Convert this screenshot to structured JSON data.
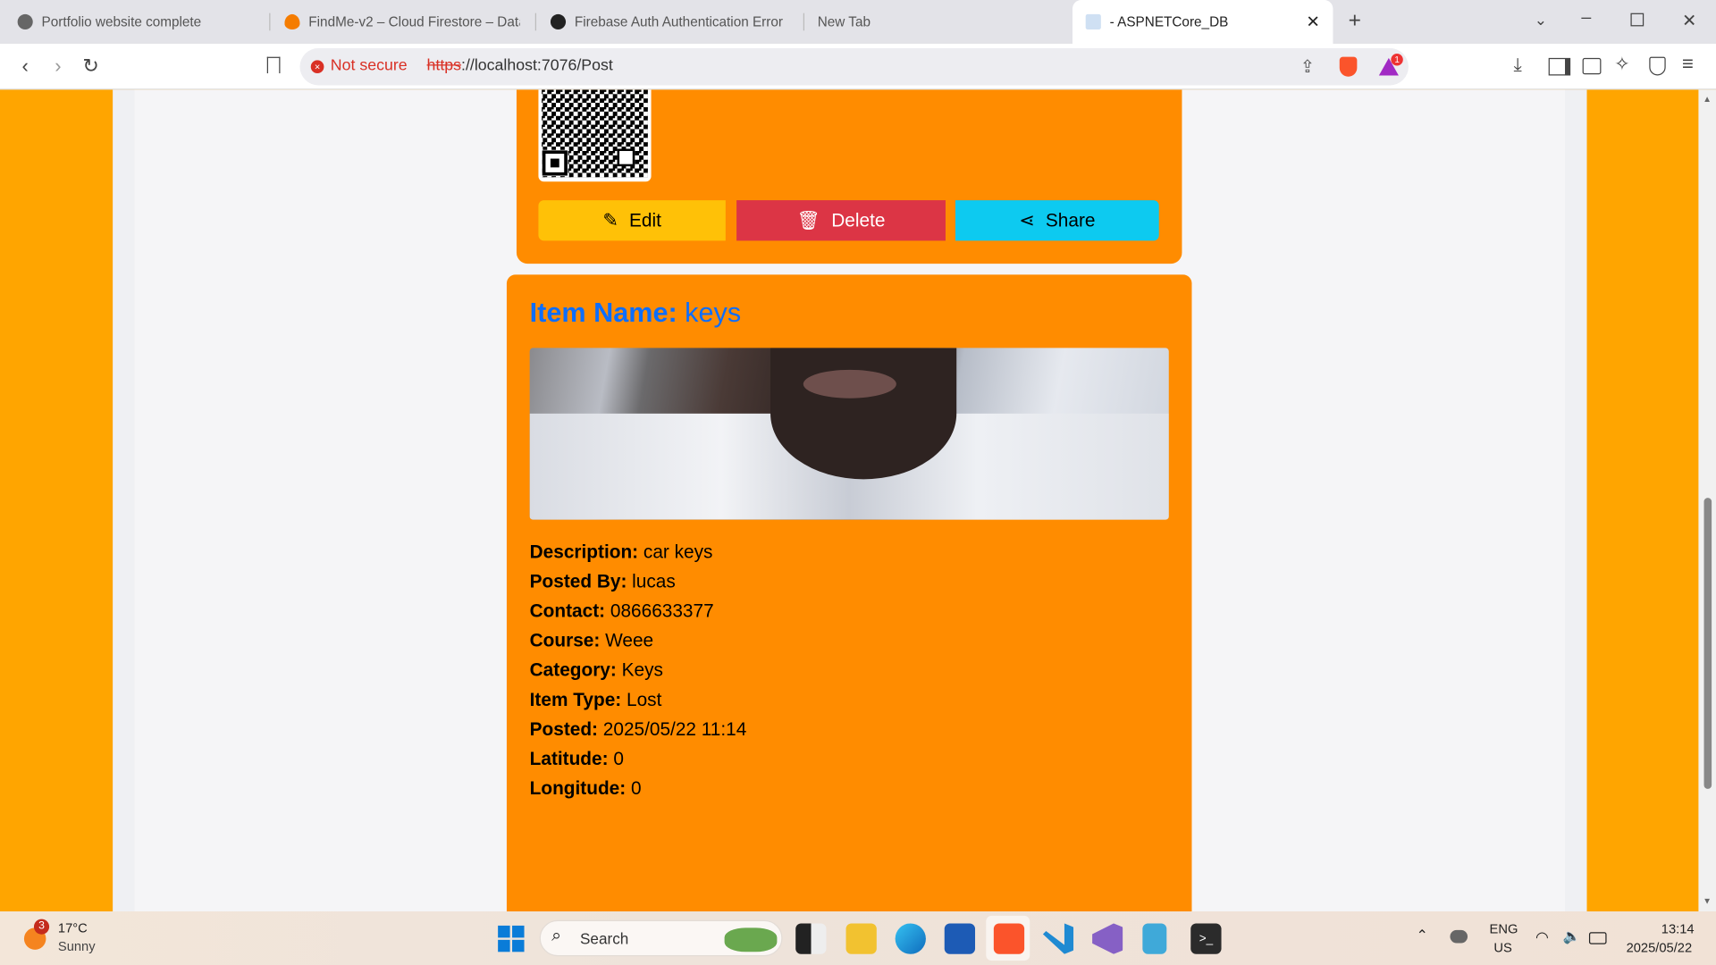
{
  "browser": {
    "tabs": [
      {
        "label": "Portfolio website complete",
        "icon": "globe-icon"
      },
      {
        "label": "FindMe-v2 – Cloud Firestore – Data",
        "icon": "firebase-icon"
      },
      {
        "label": "Firebase Auth Authentication Error",
        "icon": "openai-icon"
      },
      {
        "label": "New Tab",
        "icon": ""
      },
      {
        "label": "- ASPNETCore_DB",
        "icon": "document-icon",
        "active": true
      }
    ],
    "security_label": "Not secure",
    "url_scheme": "https",
    "url_rest": "://localhost:7076/Post",
    "notification_count": "1"
  },
  "post_actions": {
    "edit": "Edit",
    "delete": "Delete",
    "share": "Share"
  },
  "item": {
    "title_label": "Item Name:",
    "title_value": "keys",
    "fields": [
      {
        "label": "Description:",
        "value": "car keys"
      },
      {
        "label": "Posted By:",
        "value": "lucas"
      },
      {
        "label": "Contact:",
        "value": "0866633377"
      },
      {
        "label": "Course:",
        "value": "Weee"
      },
      {
        "label": "Category:",
        "value": "Keys"
      },
      {
        "label": "Item Type:",
        "value": "Lost"
      },
      {
        "label": "Posted:",
        "value": "2025/05/22 11:14"
      },
      {
        "label": "Latitude:",
        "value": "0"
      },
      {
        "label": "Longitude:",
        "value": "0"
      }
    ]
  },
  "taskbar": {
    "weather_temp": "17°C",
    "weather_desc": "Sunny",
    "weather_badge": "3",
    "search_placeholder": "Search",
    "lang_top": "ENG",
    "lang_bottom": "US",
    "time": "13:14",
    "date": "2025/05/22"
  },
  "colors": {
    "page_bg": "#ffa500",
    "card": "#ff8c00",
    "edit": "#ffc107",
    "delete": "#dc3545",
    "share": "#0dcaf0",
    "title": "#0d6efd"
  }
}
